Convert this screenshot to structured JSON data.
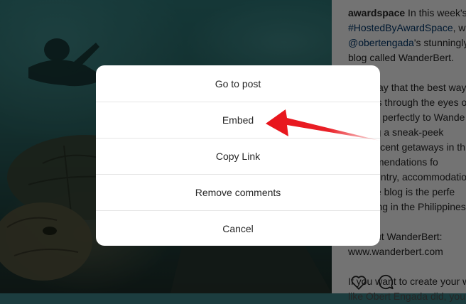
{
  "post": {
    "caption_lines": [
      {
        "parts": [
          {
            "text": "awardspace",
            "style": "bold"
          },
          {
            "text": " In this week's",
            "style": "normal"
          }
        ]
      },
      {
        "parts": [
          {
            "text": "#HostedByAwardSpace",
            "style": "link"
          },
          {
            "text": ", we",
            "style": "normal"
          }
        ]
      },
      {
        "parts": [
          {
            "text": "@obertengada",
            "style": "link"
          },
          {
            "text": "'s stunningly",
            "style": "normal"
          }
        ]
      },
      {
        "parts": [
          {
            "text": "blog called WanderBert.",
            "style": "normal"
          }
        ]
      },
      {
        "parts": [
          {
            "text": "",
            "style": "normal"
          }
        ]
      },
      {
        "parts": [
          {
            "text": "They say that the best way",
            "style": "normal"
          }
        ]
      },
      {
        "parts": [
          {
            "text": "world is through the eyes o",
            "style": "normal"
          }
        ]
      },
      {
        "parts": [
          {
            "text": "applies perfectly to Wande",
            "style": "normal"
          }
        ]
      },
      {
        "parts": [
          {
            "text": "offering a sneak-peek",
            "style": "normal"
          }
        ]
      },
      {
        "parts": [
          {
            "text": "magnificent getaways in th",
            "style": "normal"
          }
        ]
      },
      {
        "parts": [
          {
            "text": "recommendations fo",
            "style": "normal"
          }
        ]
      },
      {
        "parts": [
          {
            "text": "the country, accommodatio",
            "style": "normal"
          }
        ]
      },
      {
        "parts": [
          {
            "text": "and the blog is the perfe",
            "style": "normal"
          }
        ]
      },
      {
        "parts": [
          {
            "text": "travelling in the Philippines",
            "style": "normal"
          }
        ]
      },
      {
        "parts": [
          {
            "text": "",
            "style": "normal"
          }
        ]
      },
      {
        "parts": [
          {
            "text": "Find out WanderBert:",
            "style": "normal"
          }
        ]
      },
      {
        "parts": [
          {
            "text": "www.wanderbert.com",
            "style": "normal"
          }
        ]
      },
      {
        "parts": [
          {
            "text": "",
            "style": "normal"
          }
        ]
      },
      {
        "parts": [
          {
            "text": "If you want to create your w",
            "style": "normal"
          }
        ]
      },
      {
        "parts": [
          {
            "text": "like Obert Engada did, you",
            "style": "normal"
          }
        ]
      }
    ],
    "icons": [
      "heart-icon",
      "comment-icon"
    ]
  },
  "menu": {
    "items": [
      {
        "label": "Go to post"
      },
      {
        "label": "Embed"
      },
      {
        "label": "Copy Link"
      },
      {
        "label": "Remove comments"
      },
      {
        "label": "Cancel"
      }
    ]
  },
  "colors": {
    "arrow": "#e8141b",
    "link": "#00376b",
    "overlay": "rgba(0,0,0,0.55)"
  }
}
